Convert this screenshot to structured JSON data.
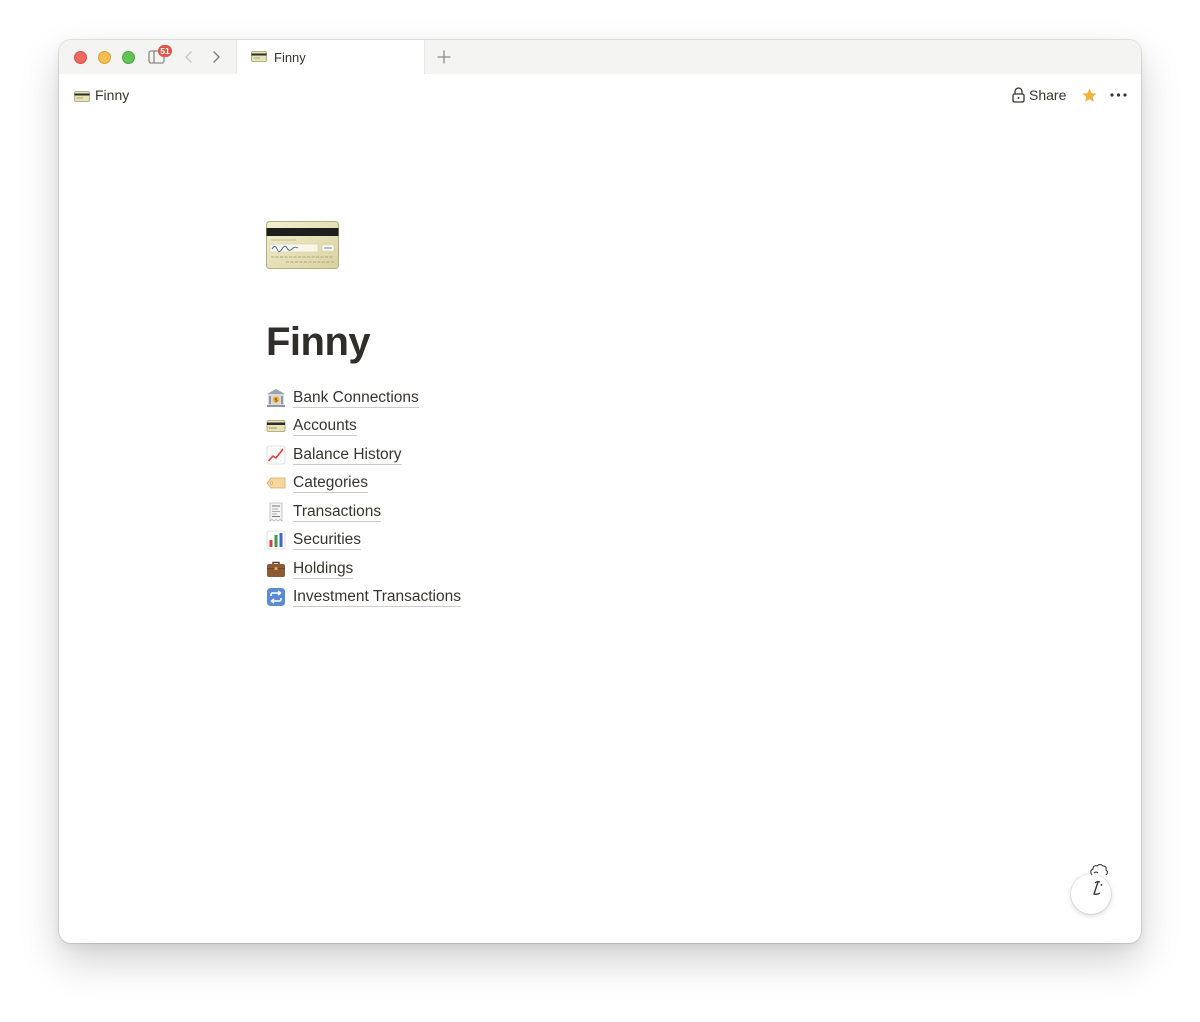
{
  "window": {
    "tab_count_badge": "51",
    "tab": {
      "title": "Finny",
      "icon": "credit-card-icon"
    }
  },
  "topbar": {
    "breadcrumb": {
      "label": "Finny",
      "icon": "credit-card-icon"
    },
    "share_label": "Share",
    "favorite_icon": "star-icon",
    "more_icon": "more-horizontal-icon"
  },
  "page": {
    "icon": "credit-card-icon",
    "title": "Finny",
    "links": [
      {
        "label": "Bank Connections",
        "icon": "bank-icon"
      },
      {
        "label": "Accounts",
        "icon": "credit-card-icon"
      },
      {
        "label": "Balance History",
        "icon": "chart-increasing-icon"
      },
      {
        "label": "Categories",
        "icon": "label-tag-icon"
      },
      {
        "label": "Transactions",
        "icon": "receipt-icon"
      },
      {
        "label": "Securities",
        "icon": "bar-chart-icon"
      },
      {
        "label": "Holdings",
        "icon": "briefcase-icon"
      },
      {
        "label": "Investment Transactions",
        "icon": "repeat-icon"
      }
    ]
  },
  "colors": {
    "text": "#37352f",
    "star": "#f2b440",
    "badge": "#e0554a"
  }
}
